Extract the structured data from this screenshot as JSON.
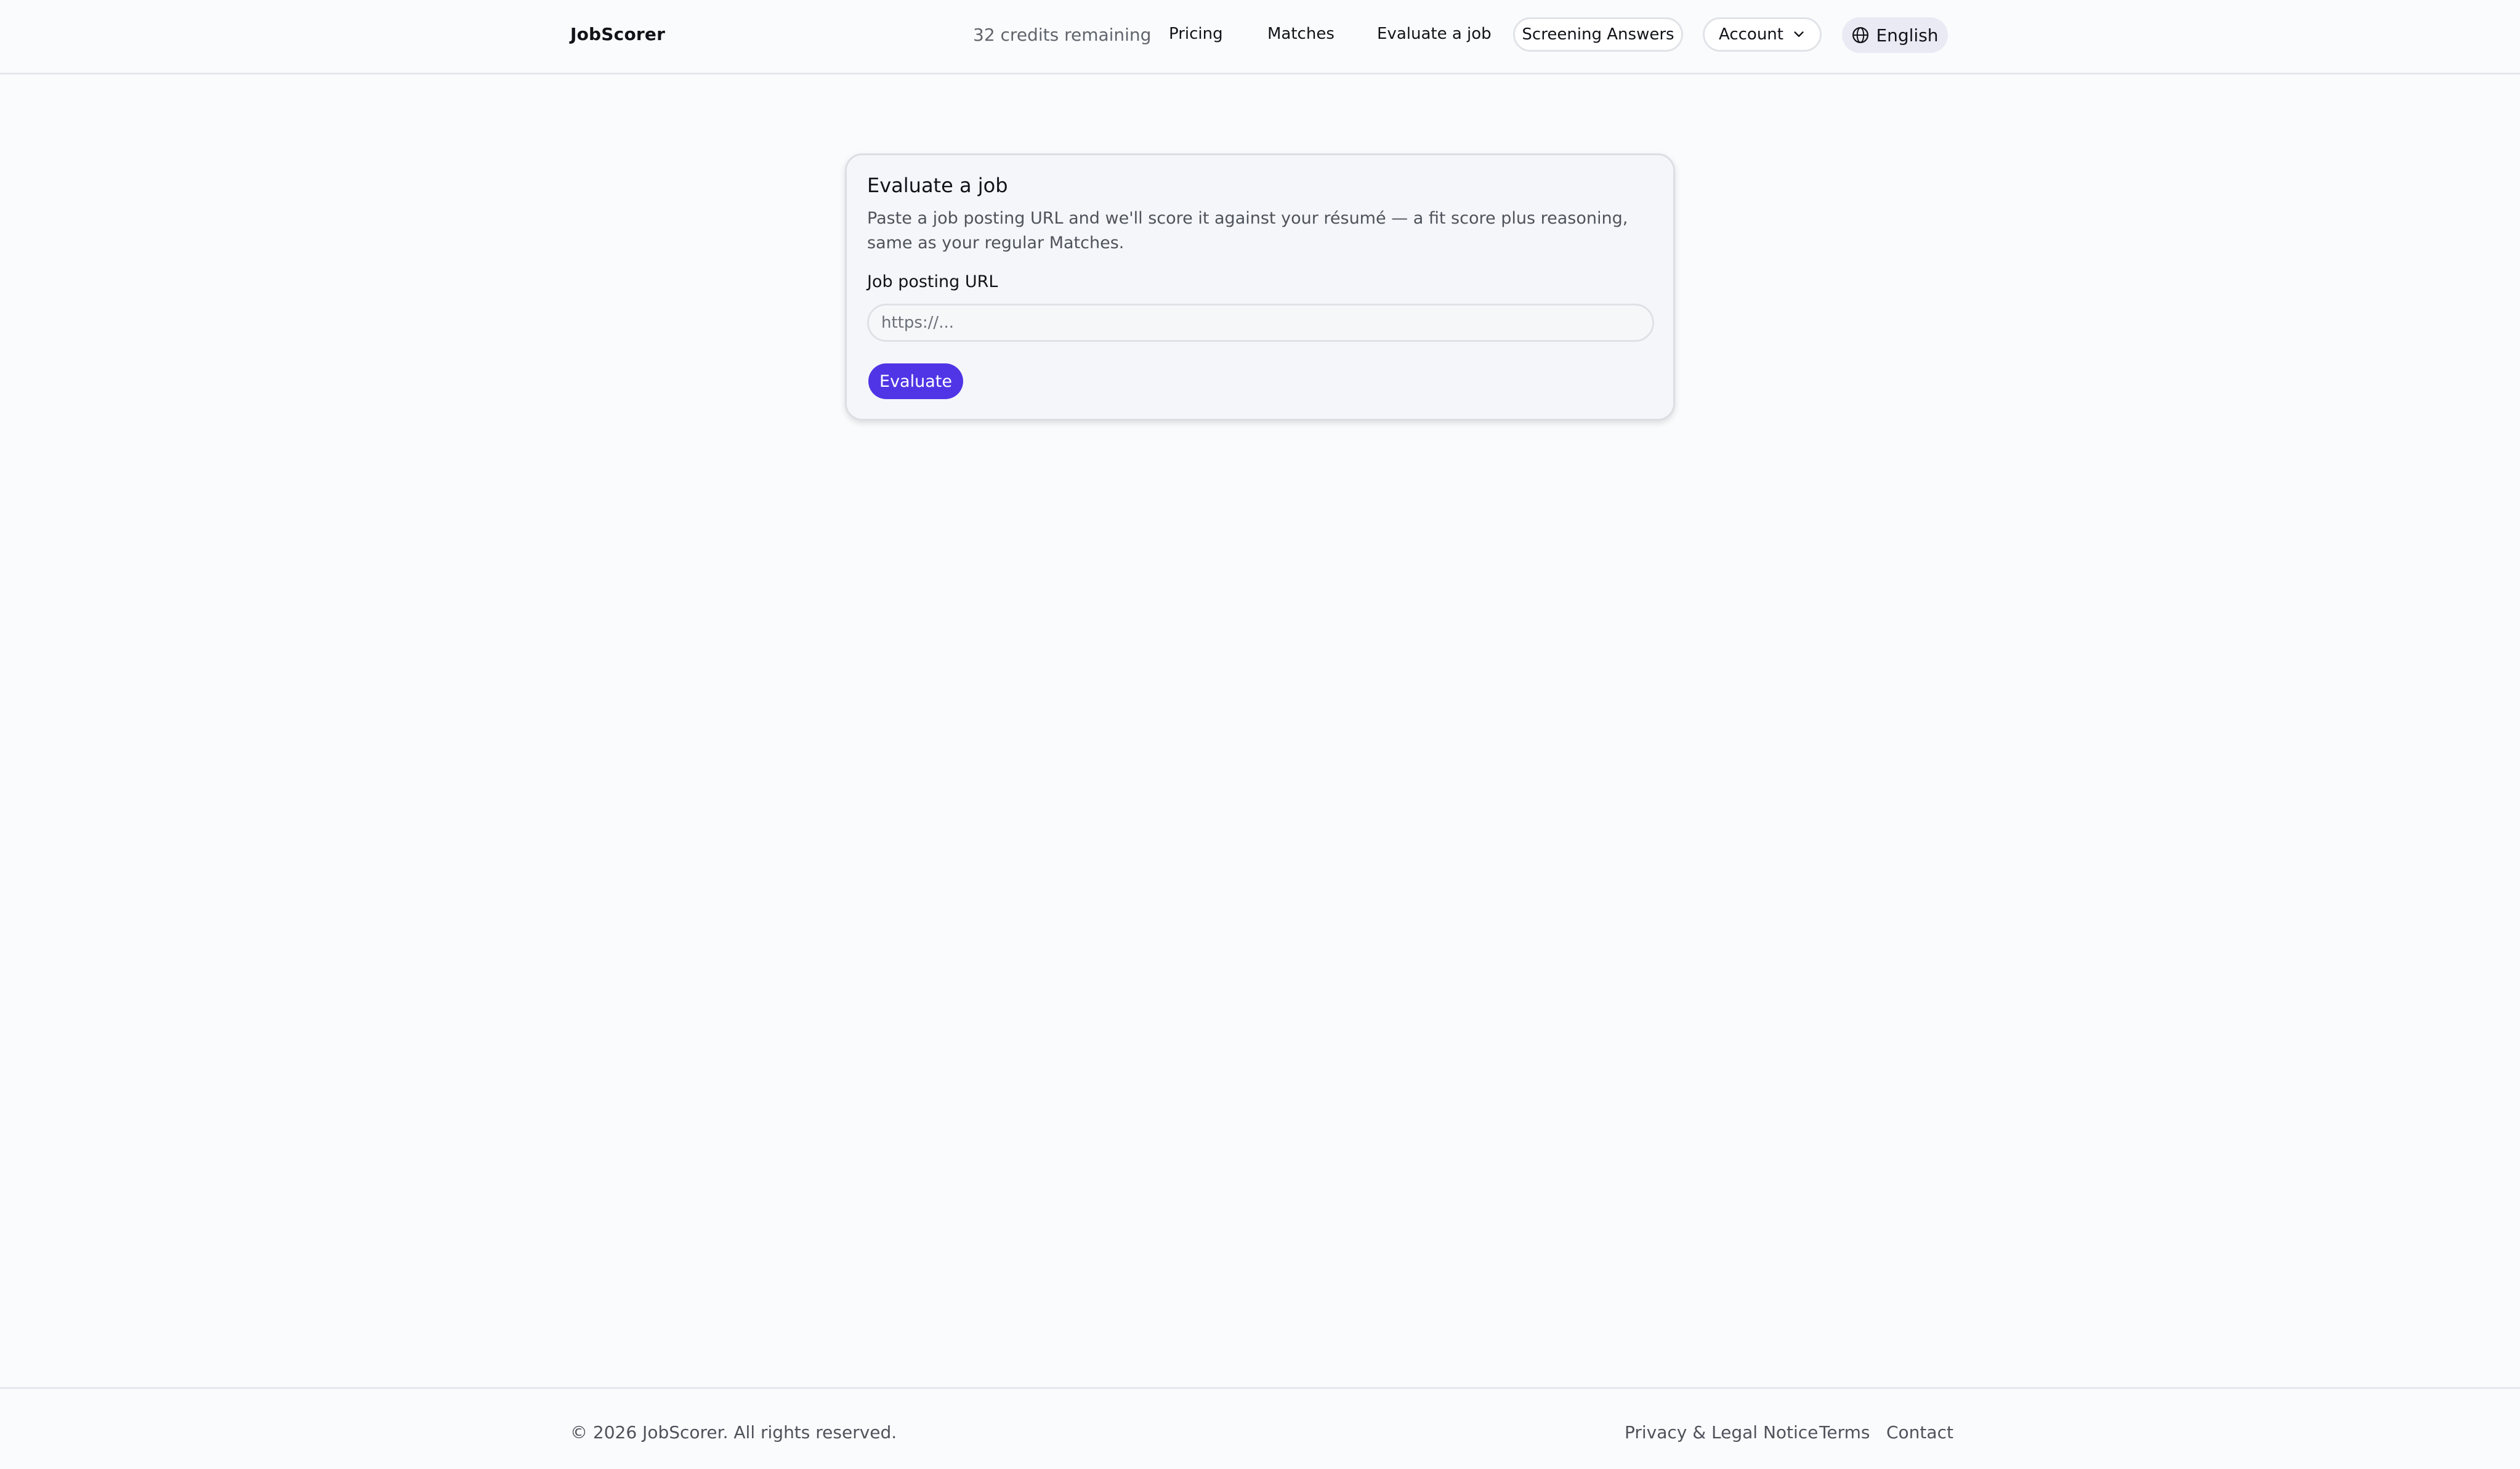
{
  "header": {
    "brand": "JobScorer",
    "credits": "32 credits remaining",
    "nav": {
      "pricing": "Pricing",
      "matches": "Matches",
      "evaluate": "Evaluate a job",
      "screening": "Screening Answers",
      "account": "Account"
    },
    "language": "English",
    "icons": {
      "account_caret": "chevron-down-icon",
      "language": "globe-icon"
    }
  },
  "card": {
    "title": "Evaluate a job",
    "description": "Paste a job posting URL and we'll score it against your résumé — a fit score plus reasoning, same as your regular Matches.",
    "field_label": "Job posting URL",
    "url_value": "",
    "url_placeholder": "https://...",
    "button_label": "Evaluate"
  },
  "footer": {
    "copyright": "© 2026 JobScorer. All rights reserved.",
    "links": {
      "privacy": "Privacy & Legal Notice",
      "terms": "Terms",
      "contact": "Contact"
    }
  },
  "colors": {
    "accent": "#4f35e6",
    "page_background": "#fafbfd",
    "card_background": "#f5f6f9",
    "language_pill": "#e9eaf4"
  }
}
